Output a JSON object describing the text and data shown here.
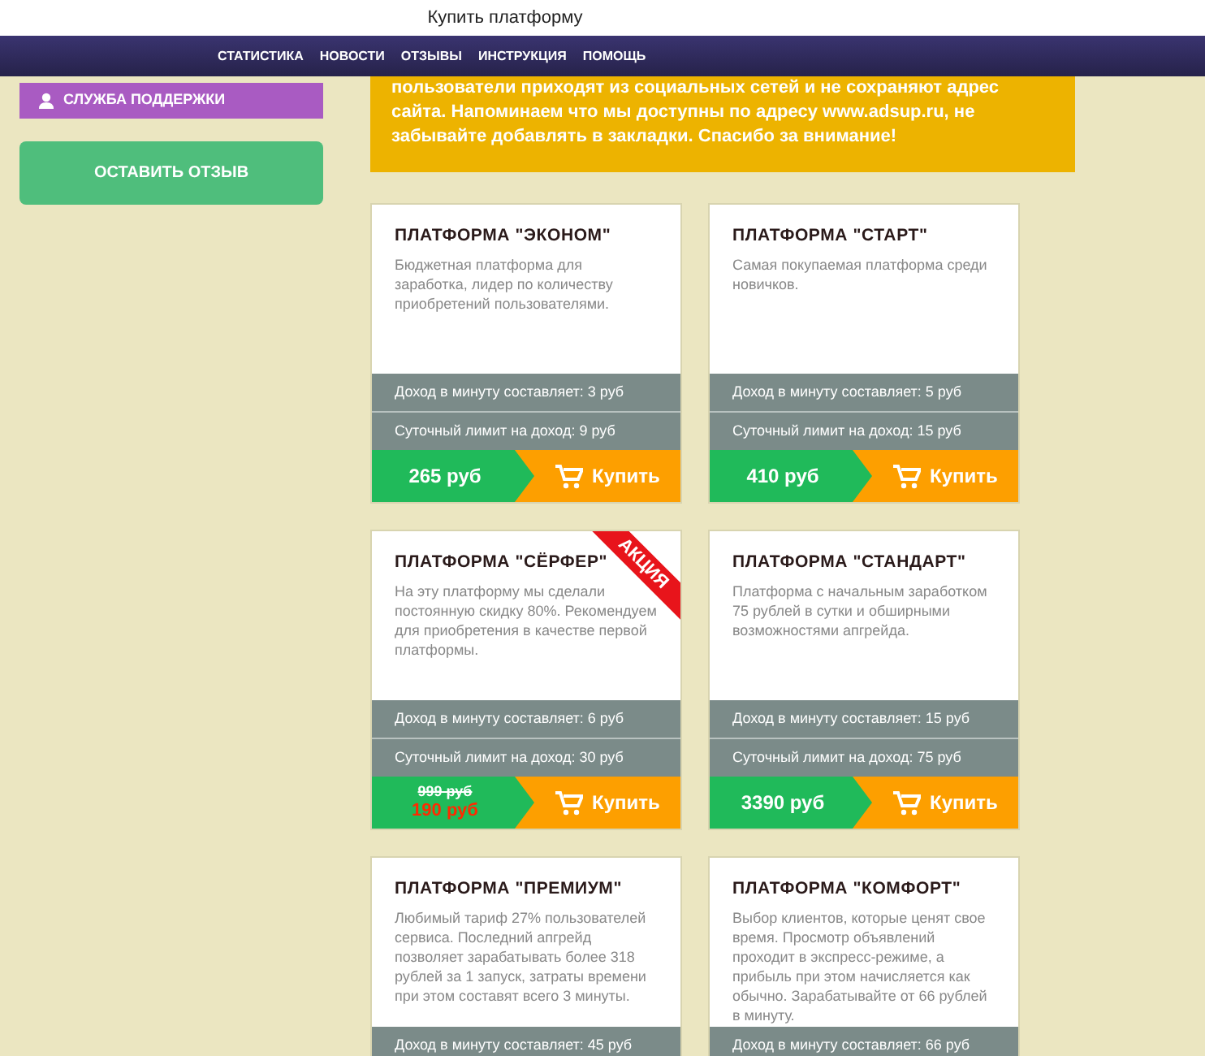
{
  "window": {
    "title": "Купить платформу"
  },
  "nav": [
    "СТАТИСТИКА",
    "НОВОСТИ",
    "ОТЗЫВЫ",
    "ИНСТРУКЦИЯ",
    "ПОМОЩЬ"
  ],
  "sidebar": {
    "support_button": "СЛУЖБА ПОДДЕРЖКИ",
    "review_button": "ОСТАВИТЬ ОТЗЫВ"
  },
  "notice": "пользователи приходят из социальных сетей и не сохраняют адрес сайта. Напоминаем что мы доступны по адресу www.adsup.ru, не забывайте добавлять в закладки. Спасибо за внимание!",
  "cards": [
    {
      "title": "ПЛАТФОРМА \"ЭКОНОМ\"",
      "description": "Бюджетная платформа для заработка, лидер по количеству приобретений пользователями.",
      "income": "Доход в минуту составляет: 3 руб",
      "limit": "Суточный лимит на доход: 9 руб",
      "price": "265 руб",
      "buy": "Купить"
    },
    {
      "title": "ПЛАТФОРМА \"СТАРТ\"",
      "description": "Самая покупаемая платформа среди новичков.",
      "income": "Доход в минуту составляет: 5 руб",
      "limit": "Суточный лимит на доход: 15 руб",
      "price": "410 руб",
      "buy": "Купить"
    },
    {
      "title": "ПЛАТФОРМА \"СЁРФЕР\"",
      "badge": "АКЦИЯ",
      "description": "На эту платформу мы сделали постоянную скидку 80%. Рекомендуем для приобретения в качестве первой платформы.",
      "income": "Доход в минуту составляет: 6 руб",
      "limit": "Суточный лимит на доход: 30 руб",
      "old_price": "999 руб",
      "price": "190 руб",
      "buy": "Купить"
    },
    {
      "title": "ПЛАТФОРМА \"СТАНДАРТ\"",
      "description": "Платформа с начальным заработком 75 рублей в сутки и обширными возможностями апгрейда.",
      "income": "Доход в минуту составляет: 15 руб",
      "limit": "Суточный лимит на доход: 75 руб",
      "price": "3390 руб",
      "buy": "Купить"
    },
    {
      "title": "ПЛАТФОРМА \"ПРЕМИУМ\"",
      "description": "Любимый тариф 27% пользователей сервиса. Последний апгрейд позволяет зарабатывать более 318 рублей за 1 запуск, затраты времени при этом составят всего 3 минуты.",
      "income": "Доход в минуту составляет: 45 руб"
    },
    {
      "title": "ПЛАТФОРМА \"КОМФОРТ\"",
      "description": "Выбор клиентов, которые ценят свое время. Просмотр объявлений проходит в экспресс-режиме, а прибыль при этом начисляется как обычно. Зарабатывайте от 66 рублей в минуту.",
      "income": "Доход в минуту составляет: 66 руб"
    }
  ]
}
